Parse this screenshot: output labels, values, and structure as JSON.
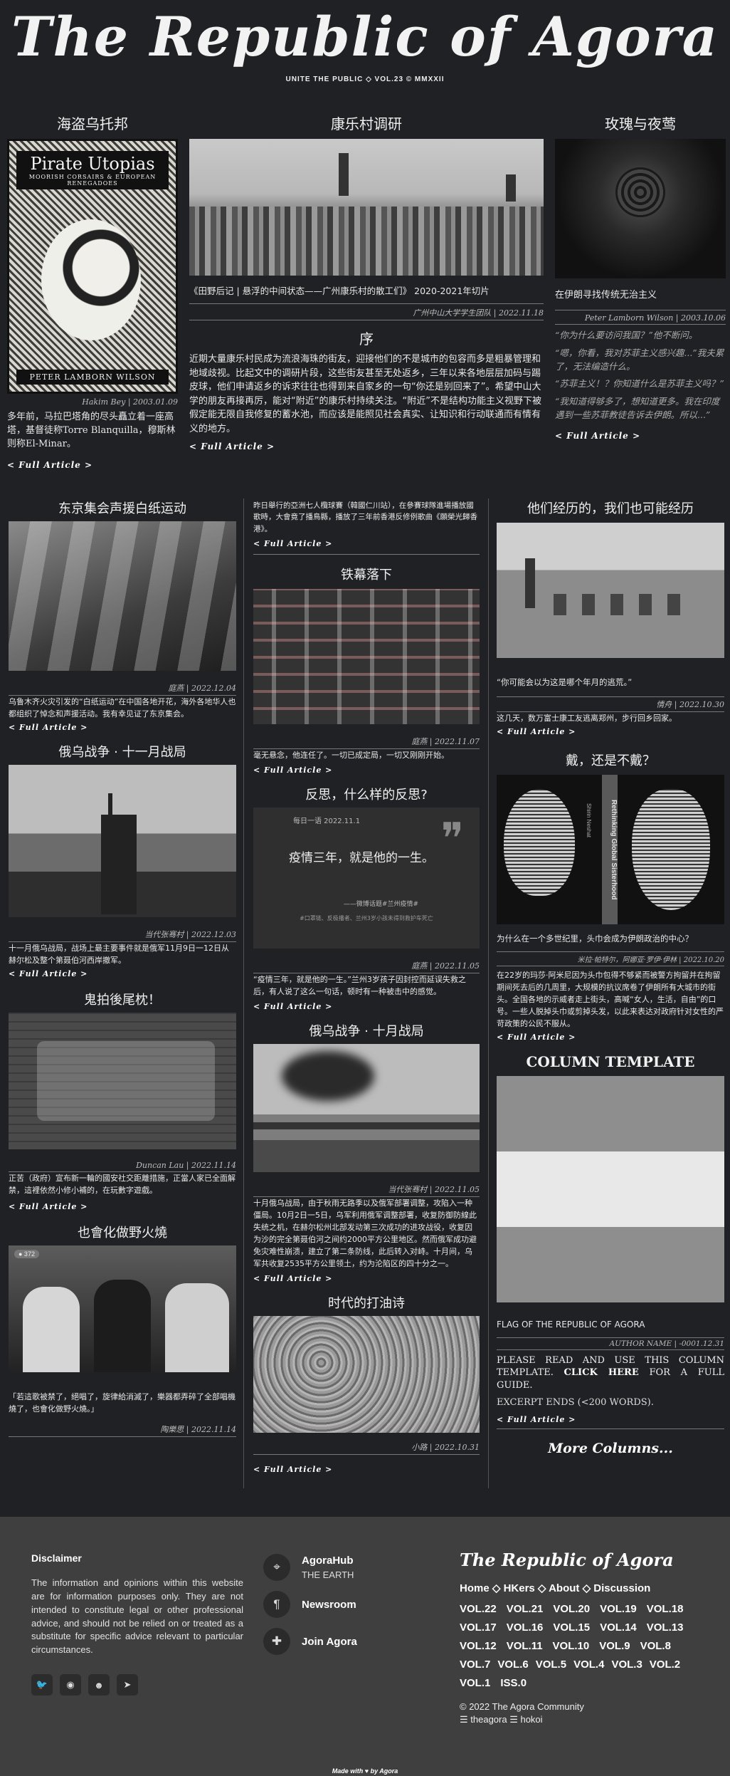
{
  "masthead": {
    "title": "The Republic of Agora",
    "subtitle": "UNITE THE PUBLIC ◇ VOL.23 © MMXXII"
  },
  "top": {
    "left": {
      "heading": "海盗乌托邦",
      "book": {
        "title": "Pirate Utopias",
        "sub": "MOORISH CORSAIRS & EUROPEAN RENEGADOES",
        "author": "PETER LAMBORN WILSON"
      },
      "meta": "Hakim Bey | 2003.01.09",
      "body": "多年前，马拉巴塔角的尽头矗立着一座高塔，基督徒称Torre Blanquilla，穆斯林则称El-Minar。",
      "more": "< Full Article >"
    },
    "center": {
      "heading": "康乐村调研",
      "caption": "《田野后记 | 悬浮的中间状态——广州康乐村的散工们》 2020-2021年切片",
      "meta": "广州中山大学学生团队 | 2022.11.18",
      "sub": "序",
      "body": "近期大量康乐村民成为流浪海珠的街友，迎接他们的不是城市的包容而多是粗暴管理和地域歧视。比起文中的调研片段，这些街友甚至无处返乡，三年以来各地层层加码与踢皮球，他们申请返乡的诉求往往也得到来自家乡的一句“你还是别回来了”。希望中山大学的朋友再接再厉，能对“附近”的康乐村持续关注。“附近”不是结构功能主义视野下被假定能无限自我修复的蓄水池，而应该是能照见社会真实、让知识和行动联通而有情有义的地方。",
      "more": "< Full Article >"
    },
    "right": {
      "heading": "玫瑰与夜莺",
      "caption": "在伊朗寻找传统无治主义",
      "meta": "Peter Lamborn Wilson | 2003.10.06",
      "quotes": [
        "“你为什么要访问我国？”他不断问。",
        "“嗯，你看，我对苏菲主义感兴趣...”我夫累了，无法编造什么。",
        "“苏菲主义！？你知道什么是苏菲主义吗？”",
        "“我知道得够多了，想知道更多。我在印度遇到一些苏菲教徒告诉去伊朗。所以...”"
      ],
      "more": "< Full Article >"
    }
  },
  "colA": [
    {
      "heading": "东京集会声援白纸运动",
      "meta": "庭燕 | 2022.12.04",
      "body": "乌鲁木齐火灾引发的“白纸运动”在中国各地开花，海外各地华人也都组织了悼念和声援活动。我有幸见证了东京集会。",
      "more": "< Full Article >"
    },
    {
      "heading": "俄乌战争 · 十一月战局",
      "meta": "当代张骞村 | 2022.12.03",
      "body": "十一月俄乌战局，战场上最主要事件就是俄军11月9日一12日从赫尔松及整个第聂伯河西岸撤军。",
      "more": "< Full Article >"
    },
    {
      "heading": "鬼拍後尾枕！",
      "meta": "Duncan Lau | 2022.11.14",
      "body": "正苦（政府）宣布新一輪的國安社交距離措施，正當人家已全面解禁，這裡依然小修小補的，在玩數字遊戲。",
      "more": "< Full Article >"
    },
    {
      "heading": "也會化做野火燒",
      "meta": "陶樂思 | 2022.11.14",
      "body": "「若這歌被禁了，絕唱了，旋律給消滅了，樂器都弄碎了全部唱機燒了，也會化做野火燒。」",
      "screen": "● 372"
    }
  ],
  "colB": [
    {
      "intro": "昨日舉行的亞洲七人欖球賽（韓國仁川站），在參賽球隊進場播放國歌時，大會竟了播鳥縣，播放了三年前香港反修例歌曲《願榮光歸香港》。",
      "more": "< Full Article >"
    },
    {
      "heading": "铁幕落下",
      "meta": "庭燕 | 2022.11.07",
      "body": "毫无悬念，他连任了。一切已成定局，一切又刚刚开始。",
      "more": "< Full Article >"
    },
    {
      "heading": "反思，什么样的反思?",
      "quote_date": "每日一语 2022.11.1",
      "quote": "疫情三年，就是他的一生。",
      "quote_src": "——微博话题#兰州疫情#",
      "quote_tags": "#口罩链、反极播者、兰州3岁小孩未得到救护车死亡",
      "meta": "庭燕 | 2022.11.05",
      "body": "“疫情三年，就是他的一生。”兰州3岁孩子因封控而延误失救之后，有人说了这么一句话，顿时有一种被击中的感觉。",
      "more": "< Full Article >"
    },
    {
      "heading": "俄乌战争 · 十月战局",
      "meta": "当代张骞村 | 2022.11.05",
      "body": "十月俄乌战局，由于秋雨无路季以及俄军部署调整，攻陷入一种僵局。10月2日一5日，乌军利用俄军调整部署，收复防御防線此失统之机，在赫尔松州北部发动第三次成功的进攻战役，收复因为沙的完全第聂伯河之间约2000平方公里地区。然而俄军成功避免灾难性崩溃，建立了第二条防线，此后转入对峙。十月间，乌军共收复2535平方公里领土，约为沦陷区的四十分之一。",
      "more": "< Full Article >"
    },
    {
      "heading": "时代的打油诗",
      "meta": "小路 | 2022.10.31",
      "more": "< Full Article >"
    }
  ],
  "colC": [
    {
      "heading": "他们经历的，我们也可能经历",
      "caption": "“你可能会以为这是哪个年月的逃荒。”",
      "meta": "情舟 | 2022.10.30",
      "body": "这几天，数万富士康工友逃离郑州，步行回乡回家。",
      "more": "< Full Article >"
    },
    {
      "heading": "戴，还是不戴？",
      "poster": "Rethinking Global Sisterhood",
      "poster_side": "Shirin Neshat",
      "caption": "为什么在一个多世纪里，头巾会成为伊朗政治的中心？",
      "meta": "米拉·帕特尔，阿娜亚·罗伊·伊林 | 2022.10.20",
      "body": "在22岁的玛莎·阿米尼因为头巾包得不够紧而被警方拘留并在拘留期间死去后的几周里，大规模的抗议席卷了伊朗所有大城市的街头。全国各地的示威者走上街头，高喊“女人，生活，自由”的口号。一些人脱掉头巾或剪掉头发，以此来表达对政府针对女性的严苛政策的公民不服从。",
      "more": "< Full Article >"
    },
    {
      "heading": "COLUMN TEMPLATE",
      "caption": "FLAG OF THE REPUBLIC OF AGORA",
      "meta": "AUTHOR NAME | -0001.12.31",
      "body1": "PLEASE READ AND USE THIS COLUMN TEMPLATE.",
      "click": "CLICK HERE",
      "body2": "FOR A FULL GUIDE.",
      "excerpt": "EXCERPT ENDS (<200 WORDS).",
      "more": "< Full Article >",
      "more_cols": "More Columns..."
    }
  ],
  "footer": {
    "disclaimer_title": "Disclaimer",
    "disclaimer": "The information and opinions within this website are for information purposes only. They are not intended to constitute legal or other professional advice, and should not be relied on or treated as a substitute for specific advice relevant to particular circumstances.",
    "links": [
      {
        "title": "AgoraHub",
        "sub": "THE EARTH"
      },
      {
        "title": "Newsroom",
        "sub": ""
      },
      {
        "title": "Join Agora",
        "sub": ""
      }
    ],
    "brand": "The Republic of Agora",
    "nav": [
      "Home",
      "HKers",
      "About",
      "Discussion"
    ],
    "vols": [
      [
        "VOL.22",
        "VOL.21",
        "VOL.20",
        "VOL.19",
        "VOL.18"
      ],
      [
        "VOL.17",
        "VOL.16",
        "VOL.15",
        "VOL.14",
        "VOL.13"
      ],
      [
        "VOL.12",
        "VOL.11",
        "VOL.10",
        "VOL.9",
        "VOL.8"
      ],
      [
        "VOL.7",
        "VOL.6",
        "VOL.5",
        "VOL.4",
        "VOL.3",
        "VOL.2"
      ],
      [
        "VOL.1",
        "ISS.0"
      ]
    ],
    "copyright": "© 2022 The Agora Community",
    "authors": "☰ theagora ☰ hokoi",
    "made": "Made with ♥ by Agora"
  }
}
